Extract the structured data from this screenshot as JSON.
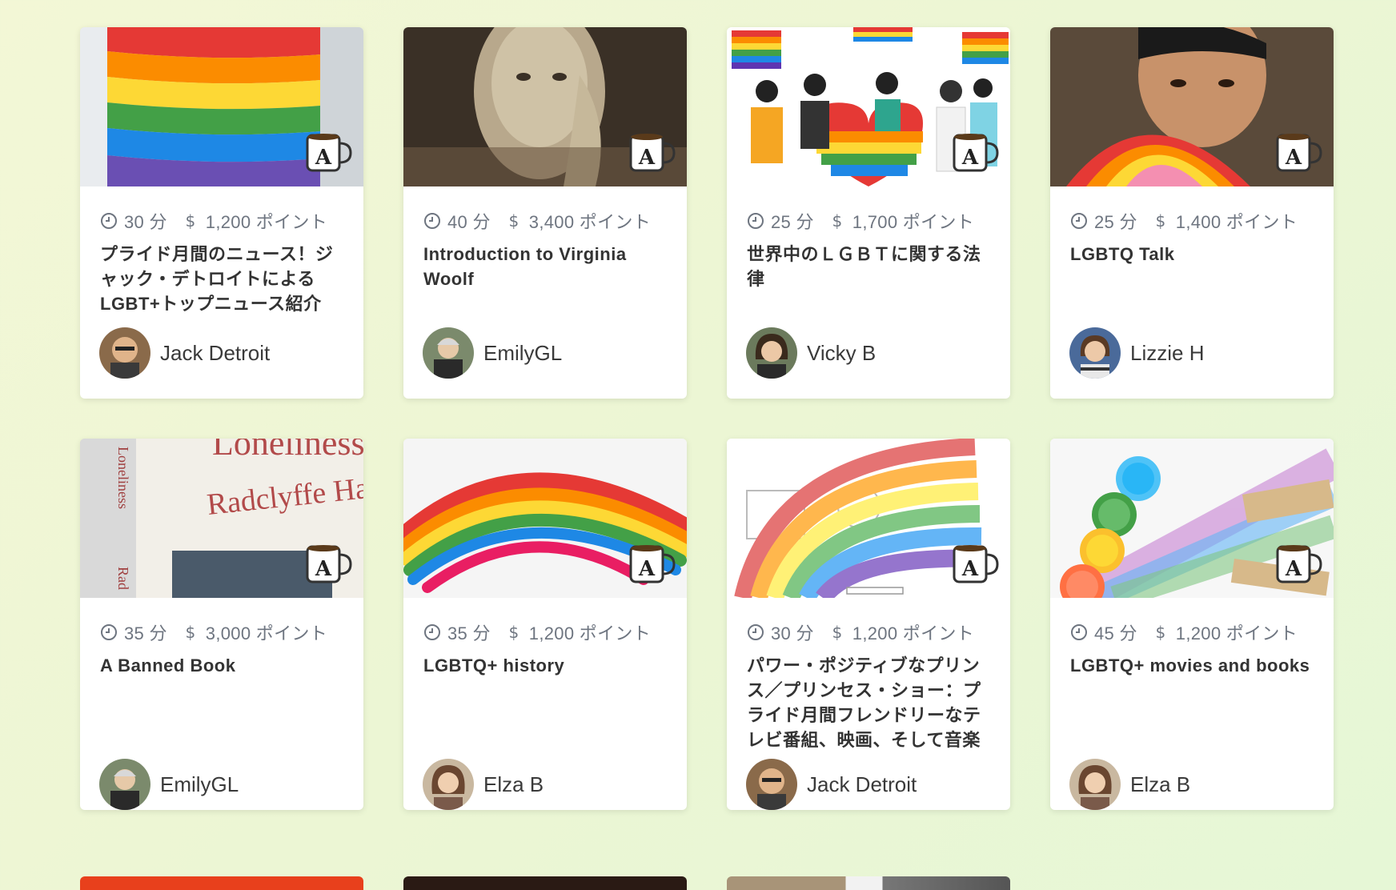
{
  "cards": [
    {
      "duration": "30 分",
      "price": "1,200 ポイント",
      "title": "プライド月間のニュース！ジャック・デトロイトによるLGBT+トップニュース紹介",
      "author": "Jack Detroit"
    },
    {
      "duration": "40 分",
      "price": "3,400 ポイント",
      "title": "Introduction to Virginia Woolf",
      "author": "EmilyGL"
    },
    {
      "duration": "25 分",
      "price": "1,700 ポイント",
      "title": "世界中のＬＧＢＴに関する法律",
      "author": "Vicky B"
    },
    {
      "duration": "25 分",
      "price": "1,400 ポイント",
      "title": "LGBTQ Talk",
      "author": "Lizzie H"
    },
    {
      "duration": "35 分",
      "price": "3,000 ポイント",
      "title": "A Banned Book",
      "author": "EmilyGL"
    },
    {
      "duration": "35 分",
      "price": "1,200 ポイント",
      "title": "LGBTQ+ history",
      "author": "Elza B"
    },
    {
      "duration": "30 分",
      "price": "1,200 ポイント",
      "title": "パワー・ポジティブなプリンス／プリンセス・ショー：プライド月間フレンドリーなテレビ番組、映画、そして音楽",
      "author": "Jack Detroit"
    },
    {
      "duration": "45 分",
      "price": "1,200 ポイント",
      "title": "LGBTQ+ movies and books",
      "author": "Elza B"
    }
  ],
  "book_cover": {
    "title_partial": "Loneliness",
    "author": "Radclyffe Hall",
    "spine": "Loneliness",
    "spine2": "Rad"
  },
  "badge_letter": "A",
  "rainbow_colors": [
    "#e53935",
    "#fb8c00",
    "#fdd835",
    "#43a047",
    "#1e88e5",
    "#5e35b1"
  ]
}
